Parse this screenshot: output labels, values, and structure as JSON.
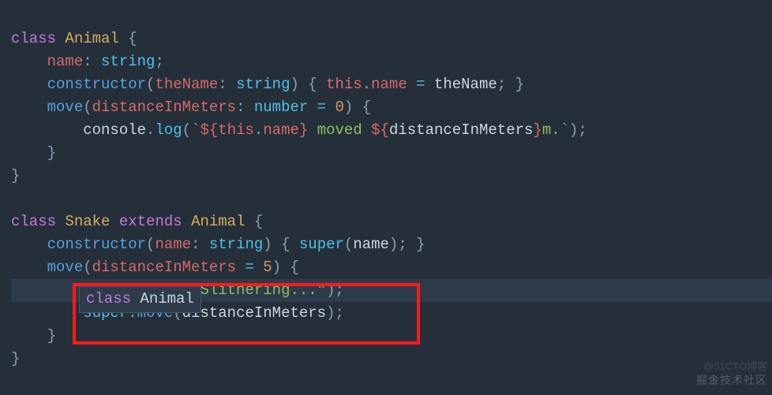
{
  "code": {
    "l1": {
      "kw_class": "class",
      "cls": "Animal",
      "brace": " {"
    },
    "l2": {
      "prop": "name",
      "colon": ": ",
      "type": "string",
      "semi": ";"
    },
    "l3": {
      "ctor": "constructor",
      "lp": "(",
      "param": "theName",
      "colon": ": ",
      "ptype": "string",
      "rp": ") { ",
      "this": "this",
      "dot": ".",
      "prop": "name",
      "eq": " = ",
      "rhs": "theName",
      "end": "; }"
    },
    "l4": {
      "fn": "move",
      "lp": "(",
      "param": "distanceInMeters",
      "colon": ": ",
      "ptype": "number",
      "eq": " = ",
      "num": "0",
      "rp": ") {"
    },
    "l5": {
      "obj": "console",
      "dot": ".",
      "log": "log",
      "lp": "(",
      "bt1": "`",
      "i1a": "${",
      "this": "this",
      "d2": ".",
      "prop": "name",
      "i1b": "}",
      "mid": " moved ",
      "i2a": "${",
      "var": "distanceInMeters",
      "i2b": "}",
      "tail": "m.",
      "bt2": "`",
      "rp": ");"
    },
    "l6": {
      "brace": "}"
    },
    "l7": {
      "brace": "}"
    },
    "l9": {
      "kw_class": "class",
      "cls": "Snake",
      "ext": "extends",
      "sup": "Animal",
      "brace": " {"
    },
    "l10": {
      "ctor": "constructor",
      "lp": "(",
      "param": "name",
      "colon": ": ",
      "ptype": "string",
      "rp": ") { ",
      "super": "super",
      "lp2": "(",
      "arg": "name",
      "rp2": "); }"
    },
    "l11": {
      "fn": "move",
      "lp": "(",
      "param": "distanceInMeters",
      "eq": " = ",
      "num": "5",
      "rp": ") {"
    },
    "l12": {
      "pre": "Slithering...\"",
      "rp": ");"
    },
    "l13": {
      "super": "super",
      "dot": ".",
      "fn": "move",
      "lp": "(",
      "arg": "distanceInMeters",
      "rp": ");"
    },
    "l14": {
      "brace": "}"
    },
    "l15": {
      "brace": "}"
    }
  },
  "tooltip": {
    "kw": "class",
    "name": "Animal"
  },
  "watermark": {
    "line1": "@51CTO博客",
    "line2": "掘金技术社区"
  }
}
